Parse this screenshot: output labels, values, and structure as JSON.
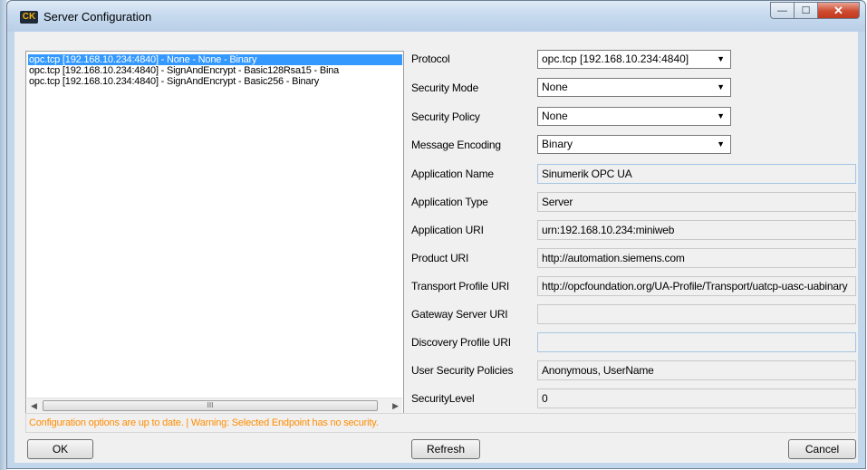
{
  "window": {
    "icon_text": "CK",
    "title": "Server Configuration",
    "minimize_glyph": "—",
    "maximize_glyph": "☐",
    "close_glyph": "✕"
  },
  "endpoints": [
    {
      "label": "opc.tcp [192.168.10.234:4840] - None - None - Binary",
      "selected": true
    },
    {
      "label": "opc.tcp [192.168.10.234:4840] - SignAndEncrypt - Basic128Rsa15 - Bina",
      "selected": false
    },
    {
      "label": "opc.tcp [192.168.10.234:4840] - SignAndEncrypt - Basic256 - Binary",
      "selected": false
    }
  ],
  "scrollbar": {
    "left_arrow": "◀",
    "right_arrow": "▶",
    "grip": "III"
  },
  "properties": {
    "protocol": {
      "label": "Protocol",
      "value": "opc.tcp [192.168.10.234:4840]"
    },
    "security_mode": {
      "label": "Security Mode",
      "value": "None"
    },
    "security_policy": {
      "label": "Security Policy",
      "value": "None"
    },
    "message_encoding": {
      "label": "Message Encoding",
      "value": "Binary"
    },
    "application_name": {
      "label": "Application Name",
      "value": "Sinumerik OPC UA"
    },
    "application_type": {
      "label": "Application Type",
      "value": "Server"
    },
    "application_uri": {
      "label": "Application URI",
      "value": "urn:192.168.10.234:miniweb"
    },
    "product_uri": {
      "label": "Product URI",
      "value": "http://automation.siemens.com"
    },
    "transport_profile_uri": {
      "label": "Transport Profile URI",
      "value": "http://opcfoundation.org/UA-Profile/Transport/uatcp-uasc-uabinary"
    },
    "gateway_server_uri": {
      "label": "Gateway Server URI",
      "value": ""
    },
    "discovery_profile_uri": {
      "label": "Discovery Profile URI",
      "value": ""
    },
    "user_security_policies": {
      "label": "User Security Policies",
      "value": "Anonymous, UserName"
    },
    "security_level": {
      "label": "SecurityLevel",
      "value": "0"
    }
  },
  "dropdown_glyph": "▼",
  "status": "Configuration options are up to date. | Warning: Selected Endpoint has no security.",
  "buttons": {
    "ok": "OK",
    "refresh": "Refresh",
    "cancel": "Cancel"
  },
  "colors": {
    "selection": "#3399ff",
    "warning_text": "#ff8c00",
    "close_button": "#c7432a"
  }
}
